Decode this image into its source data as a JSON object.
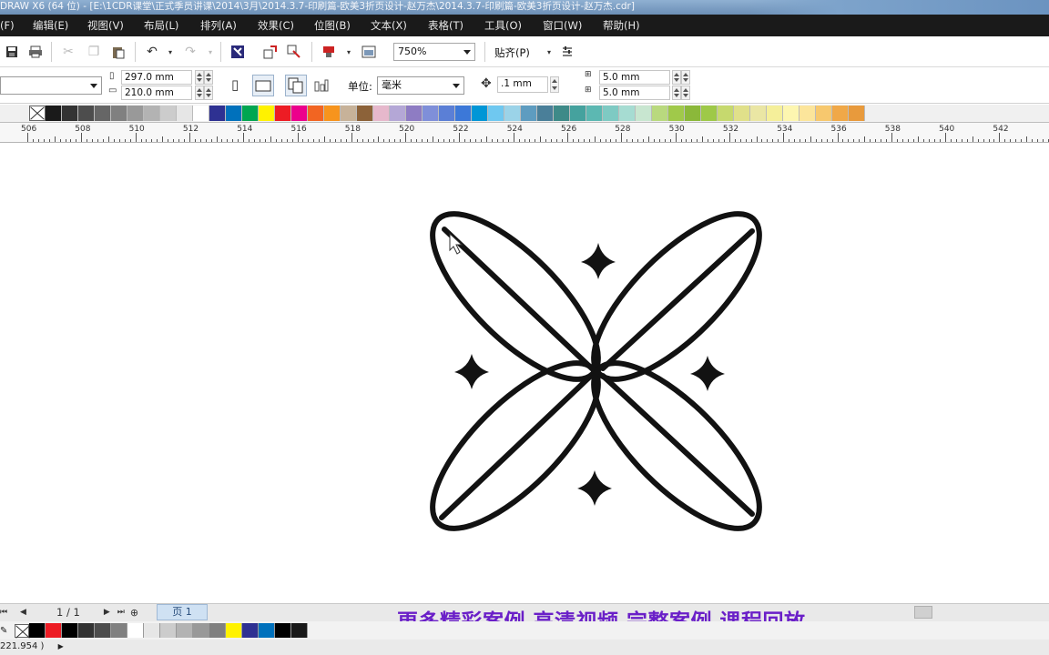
{
  "window": {
    "title": "DRAW X6 (64 位) - [E:\\1CDR课堂\\正式季员讲课\\2014\\3月\\2014.3.7-印刷篇-欧美3折页设计-赵万杰\\2014.3.7-印刷篇-欧美3折页设计-赵万杰.cdr]"
  },
  "menu": [
    {
      "label": "(F)"
    },
    {
      "label": "编辑(E)"
    },
    {
      "label": "视图(V)"
    },
    {
      "label": "布局(L)"
    },
    {
      "label": "排列(A)"
    },
    {
      "label": "效果(C)"
    },
    {
      "label": "位图(B)"
    },
    {
      "label": "文本(X)"
    },
    {
      "label": "表格(T)"
    },
    {
      "label": "工具(O)"
    },
    {
      "label": "窗口(W)"
    },
    {
      "label": "帮助(H)"
    }
  ],
  "toolbar": {
    "zoom": "750%",
    "snap_label": "贴齐(P)"
  },
  "property_bar": {
    "page_width": "297.0 mm",
    "page_height": "210.0 mm",
    "units_label": "单位:",
    "units_value": "毫米",
    "nudge": ".1 mm",
    "dup_x": "5.0 mm",
    "dup_y": "5.0 mm"
  },
  "colors": {
    "palette": [
      "#1a1a1a",
      "#333333",
      "#4d4d4d",
      "#666666",
      "#808080",
      "#999999",
      "#b3b3b3",
      "#cccccc",
      "#e6e6e6",
      "#ffffff",
      "#2e3192",
      "#0071bc",
      "#00a651",
      "#fff200",
      "#ed1c24",
      "#ec008c",
      "#f26522",
      "#f7941d",
      "#c7b299",
      "#8c6239",
      "#e6b8cc",
      "#b4a7d6",
      "#8e7cc3",
      "#7f8fd9",
      "#5b7fd6",
      "#3c78d8",
      "#0096d6",
      "#6fc8f0",
      "#9bd3e8",
      "#5e9cc0",
      "#4a7f99",
      "#3e8a88",
      "#45a29e",
      "#5cb8b2",
      "#7ecac3",
      "#a6dcd2",
      "#c8e6d0",
      "#b9d97e",
      "#a0c94a",
      "#8bb83a",
      "#9ec948",
      "#c6d96e",
      "#e0e08a",
      "#eae6a4",
      "#f5ef9a",
      "#fdf6b0",
      "#fce59b",
      "#f7c86e",
      "#f0a848",
      "#e89a3c"
    ],
    "document_palette": [
      "#000000",
      "#ed1c24",
      "#000000",
      "#333333",
      "#4d4d4d",
      "#808080",
      "#ffffff",
      "#e6e6e6",
      "#cccccc",
      "#b3b3b3",
      "#999999",
      "#808080",
      "#fff200",
      "#2e3192",
      "#0071bc",
      "#000000",
      "#1a1a1a"
    ],
    "promo": "#6a1fc8"
  },
  "ruler": {
    "labels": [
      "506",
      "508",
      "510",
      "512",
      "514",
      "516",
      "518",
      "520",
      "522",
      "524",
      "526",
      "528",
      "530",
      "532",
      "534",
      "536",
      "538",
      "540",
      "542"
    ]
  },
  "statusbar": {
    "page_counter": "1 / 1",
    "page_tab": "页 1",
    "coordinates": "221.954 )"
  },
  "promo_text": "更多精彩案例 高清视频 完整案例 课程回放"
}
